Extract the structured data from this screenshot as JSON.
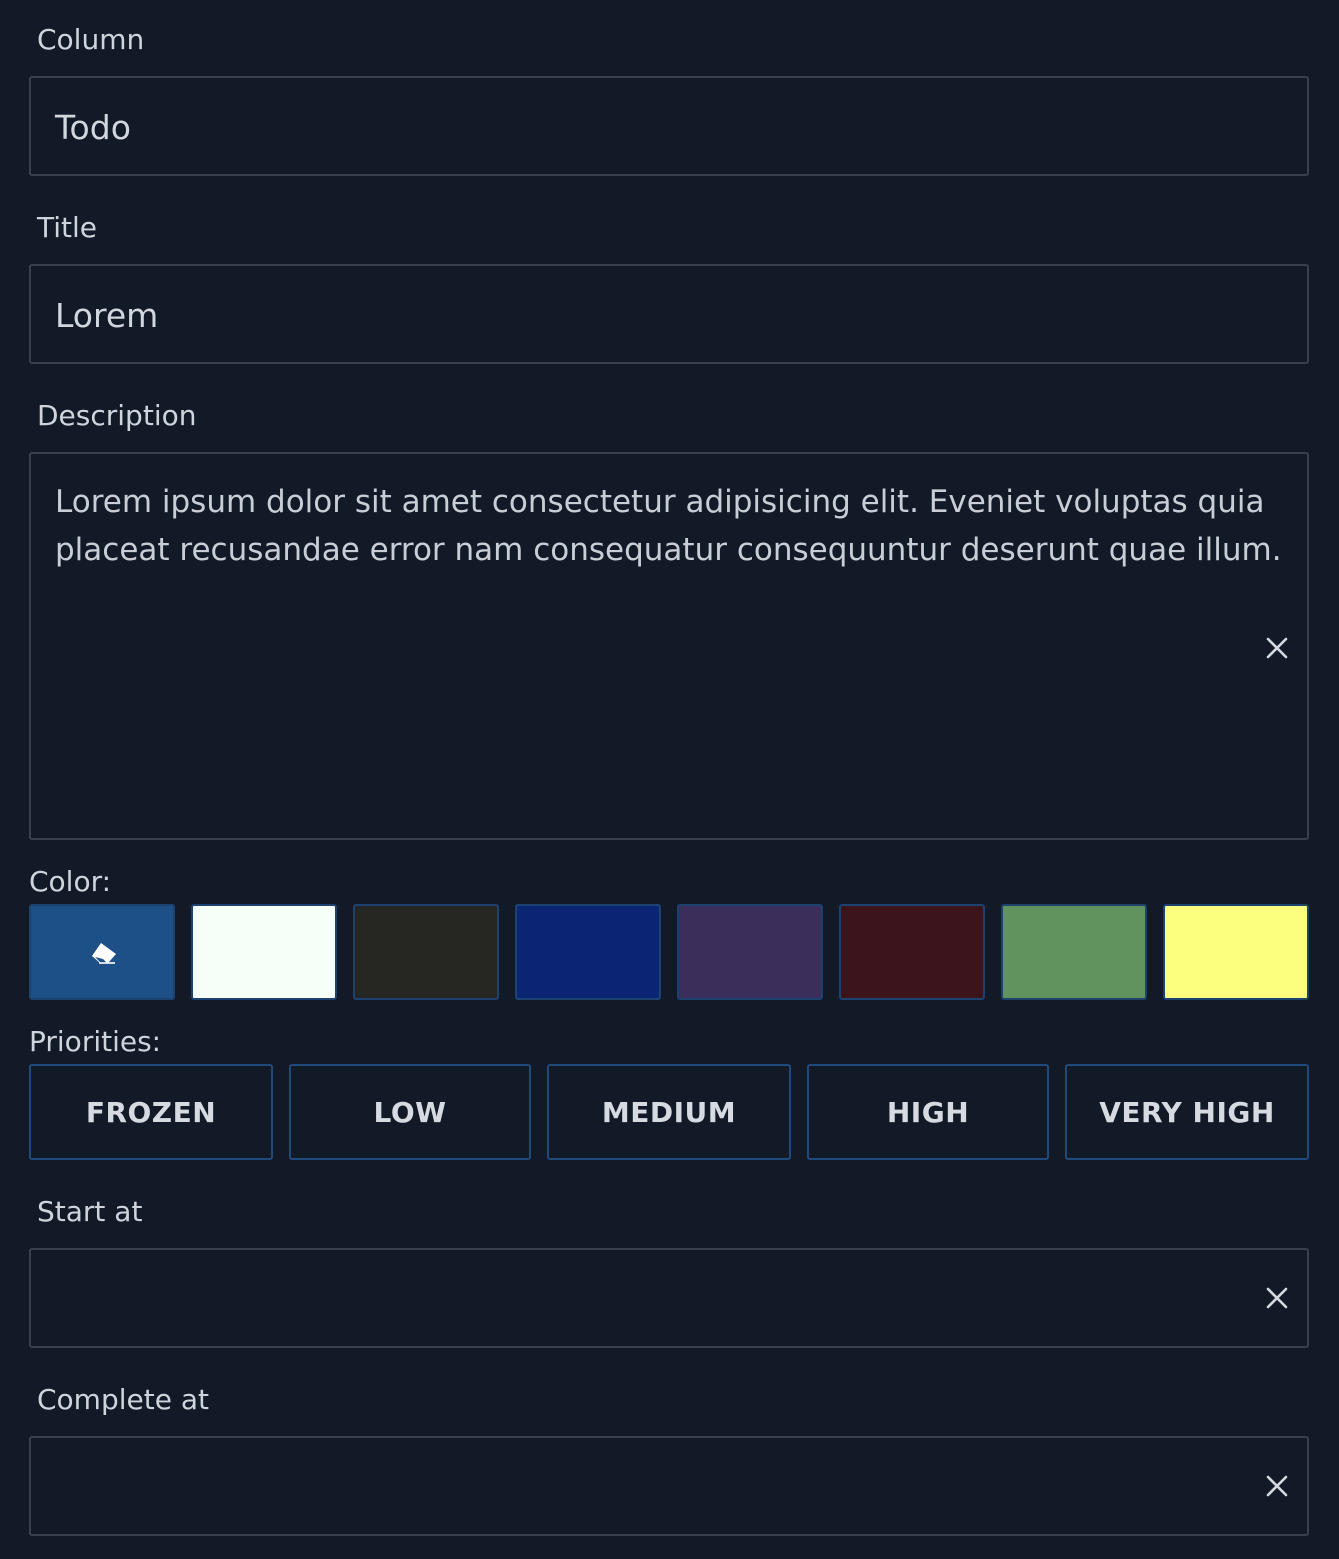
{
  "column": {
    "label": "Column",
    "value": "Todo"
  },
  "title": {
    "label": "Title",
    "value": "Lorem"
  },
  "description": {
    "label": "Description",
    "value": "Lorem ipsum dolor sit amet consectetur adipisicing elit. Eveniet voluptas quia placeat recusandae error nam consequatur consequuntur deserunt quae illum."
  },
  "color": {
    "label": "Color:",
    "swatches": [
      {
        "name": "none",
        "hex": "#1e5088",
        "icon": "eraser-icon"
      },
      {
        "name": "white",
        "hex": "#f7fff9"
      },
      {
        "name": "dark",
        "hex": "#262722"
      },
      {
        "name": "navy",
        "hex": "#0b2473"
      },
      {
        "name": "purple",
        "hex": "#3b2e5a"
      },
      {
        "name": "maroon",
        "hex": "#3c141c"
      },
      {
        "name": "green",
        "hex": "#61935f"
      },
      {
        "name": "yellow",
        "hex": "#fbff7d"
      }
    ]
  },
  "priorities": {
    "label": "Priorities:",
    "options": [
      "FROZEN",
      "LOW",
      "MEDIUM",
      "HIGH",
      "VERY HIGH"
    ]
  },
  "start_at": {
    "label": "Start at",
    "value": ""
  },
  "complete_at": {
    "label": "Complete at",
    "value": ""
  }
}
